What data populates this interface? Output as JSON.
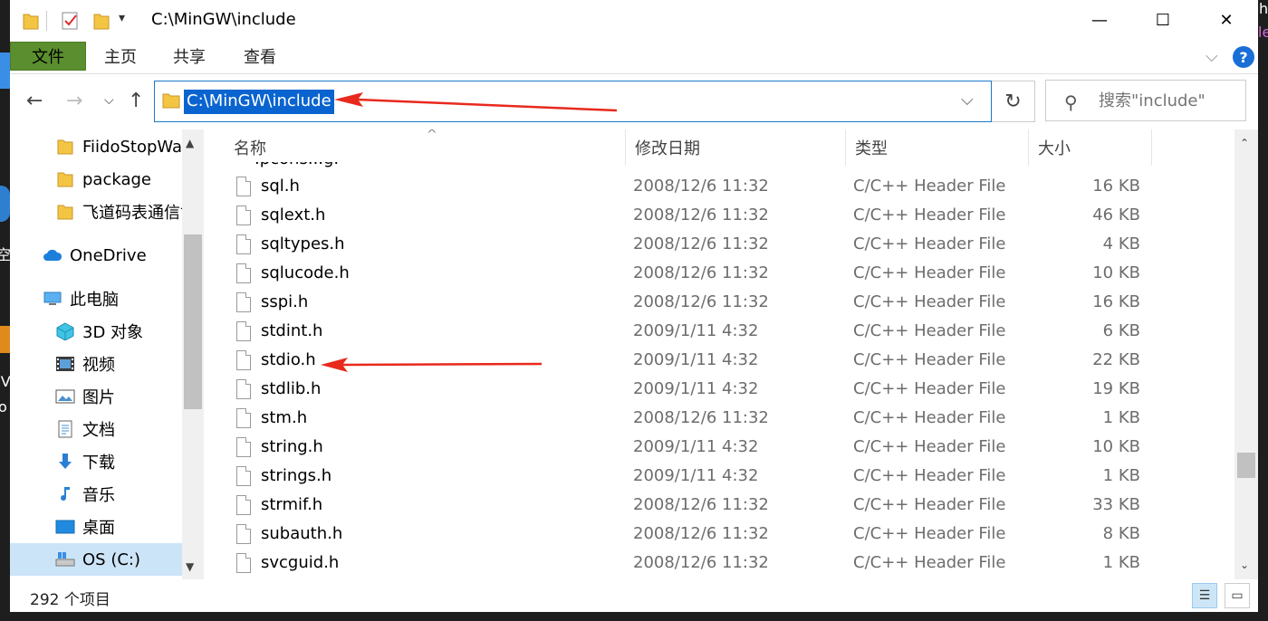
{
  "window": {
    "title": "C:\\MinGW\\include",
    "minimize_glyph": "—",
    "maximize_glyph": "☐",
    "close_glyph": "✕"
  },
  "ribbon": {
    "tabs": [
      "文件",
      "主页",
      "共享",
      "查看"
    ],
    "help_glyph": "?"
  },
  "address_bar": {
    "path": "C:\\MinGW\\include"
  },
  "search": {
    "placeholder": "搜索\"include\""
  },
  "nav_pane": {
    "items": [
      {
        "label": "FiidoStopWa",
        "icon": "folder-icon"
      },
      {
        "label": "package",
        "icon": "folder-icon"
      },
      {
        "label": "飞道码表通信协",
        "icon": "folder-icon"
      },
      {
        "label": "OneDrive",
        "icon": "cloud-icon"
      },
      {
        "label": "此电脑",
        "icon": "computer-icon"
      },
      {
        "label": "3D 对象",
        "icon": "3d-objects-icon"
      },
      {
        "label": "视频",
        "icon": "video-icon"
      },
      {
        "label": "图片",
        "icon": "pictures-icon"
      },
      {
        "label": "文档",
        "icon": "documents-icon"
      },
      {
        "label": "下载",
        "icon": "download-icon"
      },
      {
        "label": "音乐",
        "icon": "music-icon"
      },
      {
        "label": "桌面",
        "icon": "desktop-icon"
      },
      {
        "label": "OS (C:)",
        "icon": "drive-icon"
      }
    ]
  },
  "columns": {
    "name": "名称",
    "date": "修改日期",
    "type": "类型",
    "size": "大小"
  },
  "files": [
    {
      "name": "sql.h",
      "date": "2008/12/6 11:32",
      "type": "C/C++ Header File",
      "size": "16 KB"
    },
    {
      "name": "sqlext.h",
      "date": "2008/12/6 11:32",
      "type": "C/C++ Header File",
      "size": "46 KB"
    },
    {
      "name": "sqltypes.h",
      "date": "2008/12/6 11:32",
      "type": "C/C++ Header File",
      "size": "4 KB"
    },
    {
      "name": "sqlucode.h",
      "date": "2008/12/6 11:32",
      "type": "C/C++ Header File",
      "size": "10 KB"
    },
    {
      "name": "sspi.h",
      "date": "2008/12/6 11:32",
      "type": "C/C++ Header File",
      "size": "16 KB"
    },
    {
      "name": "stdint.h",
      "date": "2009/1/11 4:32",
      "type": "C/C++ Header File",
      "size": "6 KB"
    },
    {
      "name": "stdio.h",
      "date": "2009/1/11 4:32",
      "type": "C/C++ Header File",
      "size": "22 KB"
    },
    {
      "name": "stdlib.h",
      "date": "2009/1/11 4:32",
      "type": "C/C++ Header File",
      "size": "19 KB"
    },
    {
      "name": "stm.h",
      "date": "2008/12/6 11:32",
      "type": "C/C++ Header File",
      "size": "1 KB"
    },
    {
      "name": "string.h",
      "date": "2009/1/11 4:32",
      "type": "C/C++ Header File",
      "size": "10 KB"
    },
    {
      "name": "strings.h",
      "date": "2009/1/11 4:32",
      "type": "C/C++ Header File",
      "size": "1 KB"
    },
    {
      "name": "strmif.h",
      "date": "2008/12/6 11:32",
      "type": "C/C++ Header File",
      "size": "33 KB"
    },
    {
      "name": "subauth.h",
      "date": "2008/12/6 11:32",
      "type": "C/C++ Header File",
      "size": "8 KB"
    },
    {
      "name": "svcguid.h",
      "date": "2008/12/6 11:32",
      "type": "C/C++ Header File",
      "size": "1 KB"
    }
  ],
  "status": {
    "item_count": "292 个项目"
  },
  "background_fragments": [
    "空",
    "IV",
    "o",
    "h",
    "le"
  ]
}
